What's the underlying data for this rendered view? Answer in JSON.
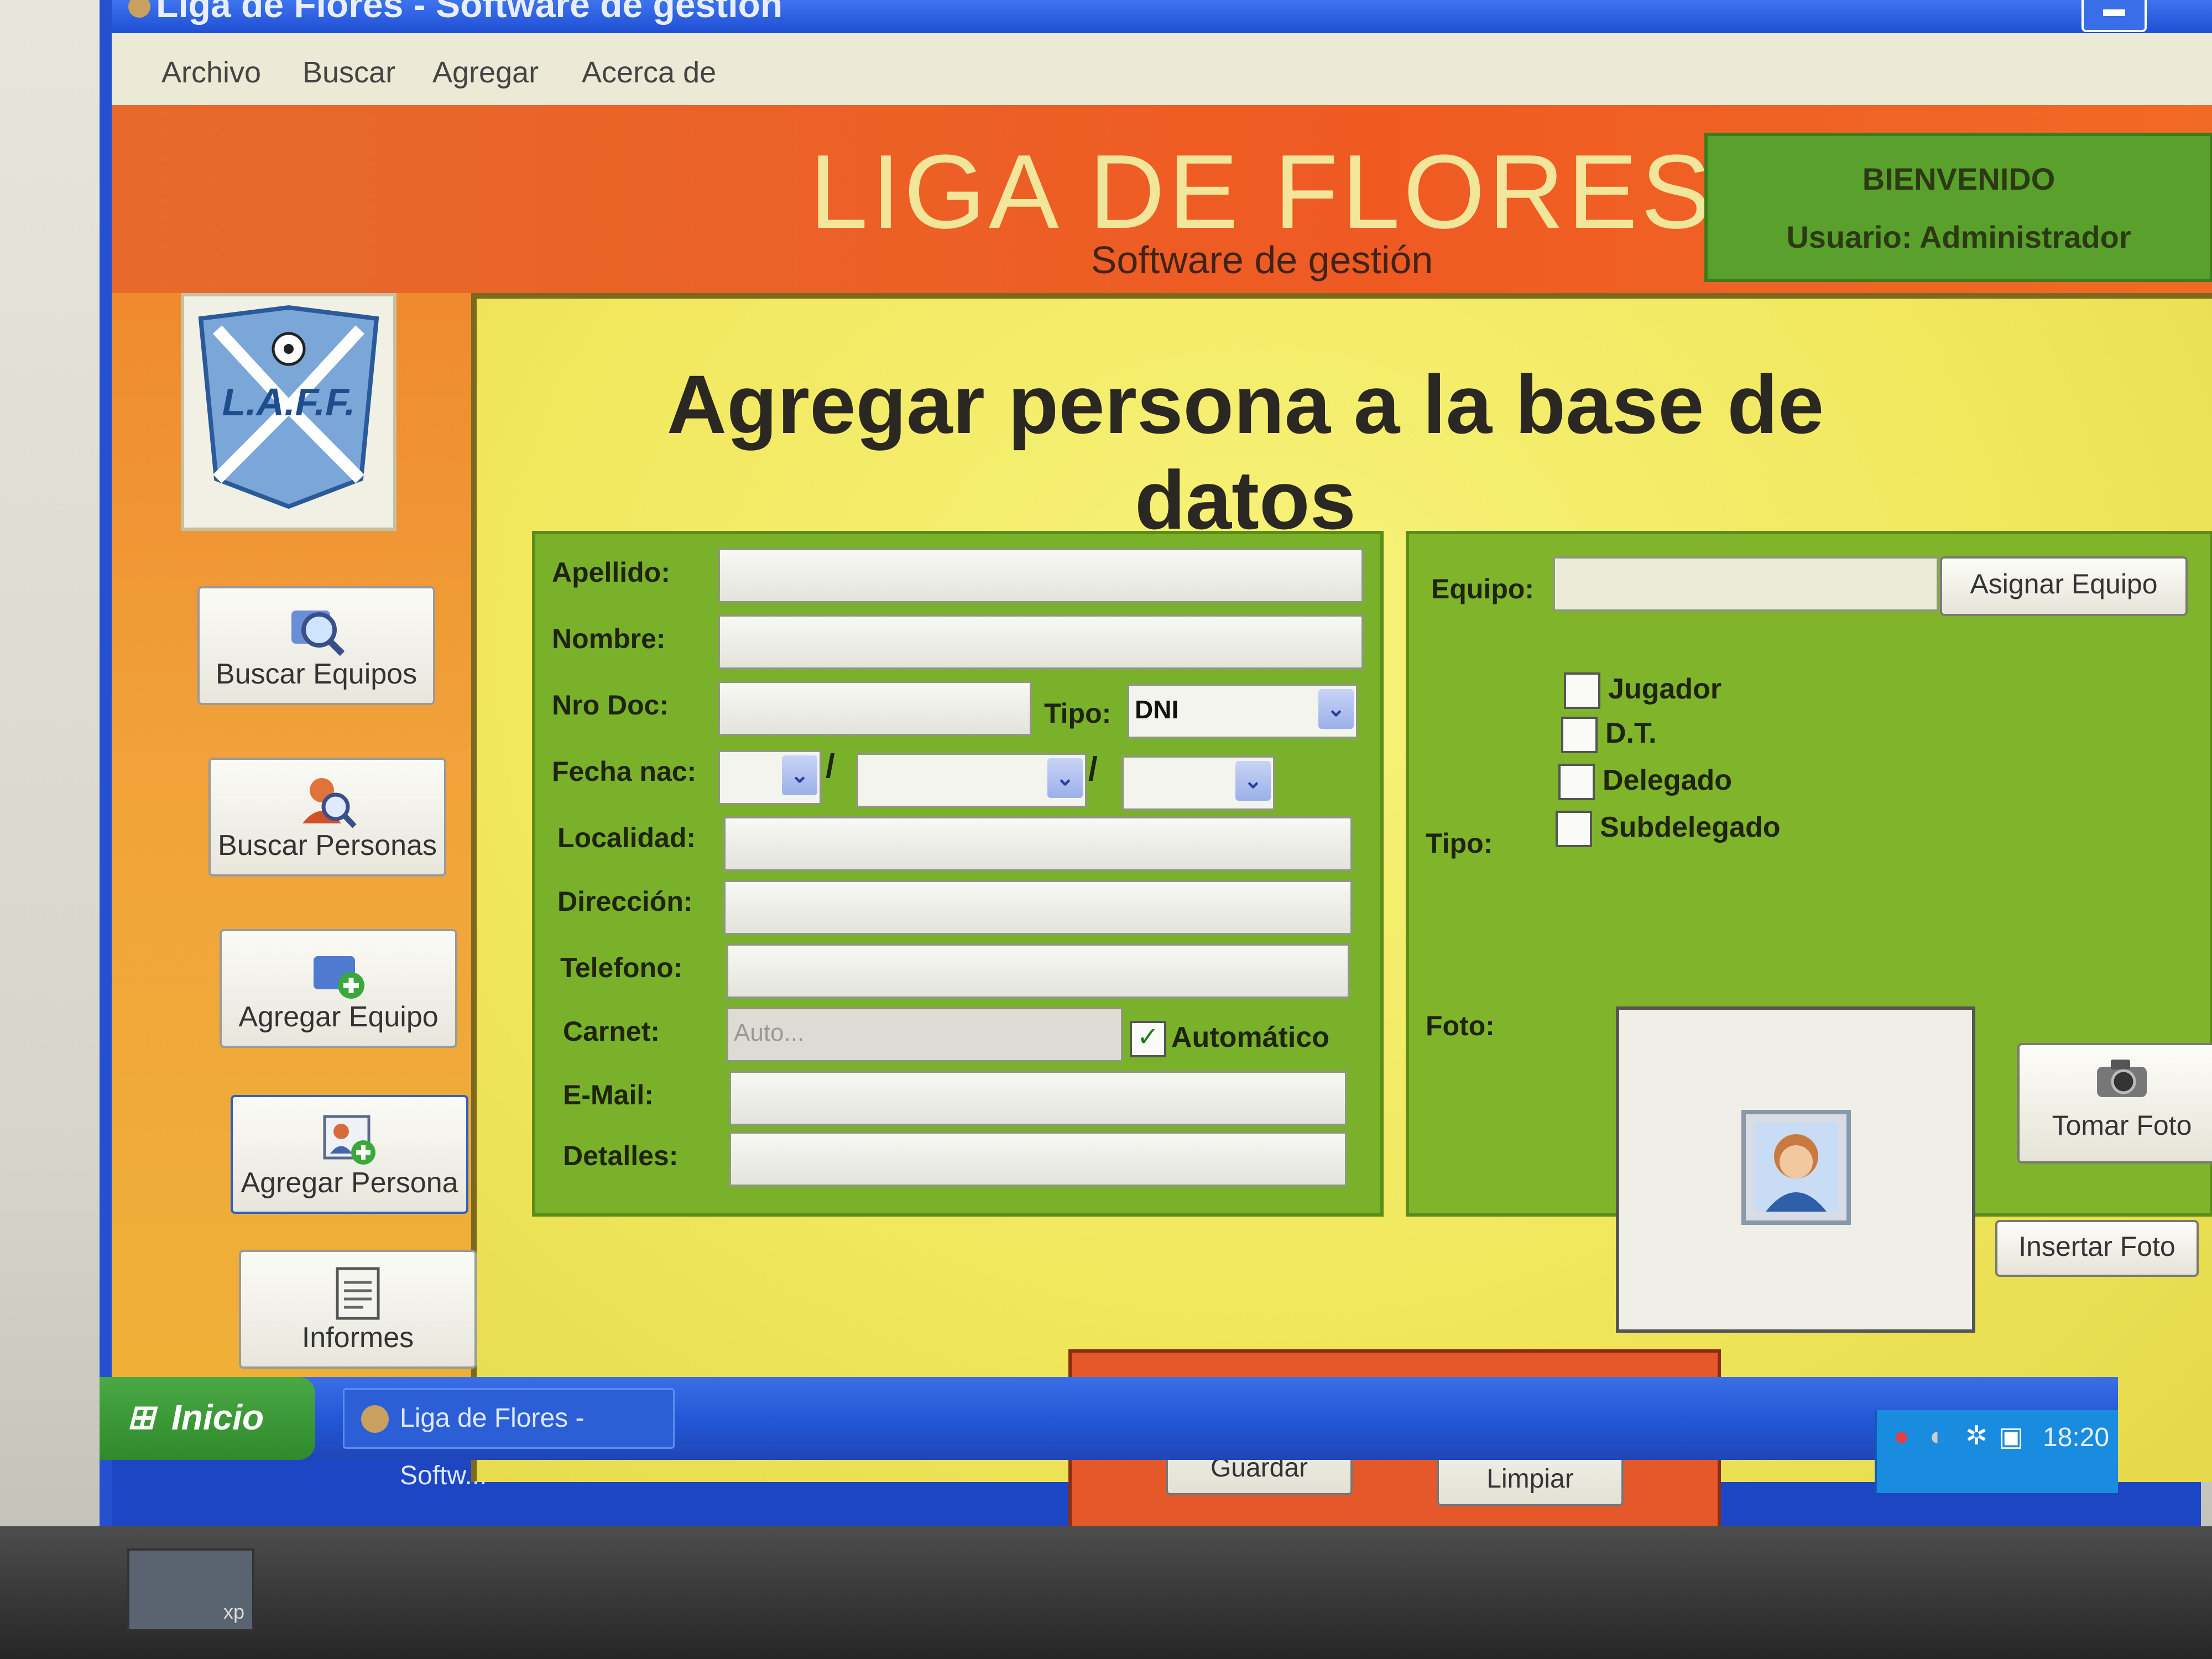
{
  "window": {
    "title": "Liga de Flores - Software de gestión"
  },
  "menu": [
    "Archivo",
    "Buscar",
    "Agregar",
    "Acerca de"
  ],
  "header": {
    "app_title": "LIGA DE FLORES",
    "app_subtitle": "Software de gestión",
    "welcome": "BIENVENIDO",
    "user": "Usuario: Administrador"
  },
  "sidebar": {
    "buttons": [
      {
        "label": "Buscar Equipos",
        "icon": "search-teams-icon"
      },
      {
        "label": "Buscar Personas",
        "icon": "search-person-icon"
      },
      {
        "label": "Agregar Equipo",
        "icon": "add-team-icon"
      },
      {
        "label": "Agregar Persona",
        "icon": "add-person-icon"
      },
      {
        "label": "Informes",
        "icon": "report-icon"
      }
    ]
  },
  "page_title": "Agregar persona a la base de datos",
  "form": {
    "apellido_label": "Apellido:",
    "nombre_label": "Nombre:",
    "nrodoc_label": "Nro Doc:",
    "tipo_label": "Tipo:",
    "tipo_value": "DNI",
    "fecha_label": "Fecha nac:",
    "date_sep": "/",
    "localidad_label": "Localidad:",
    "direccion_label": "Dirección:",
    "telefono_label": "Telefono:",
    "carnet_label": "Carnet:",
    "carnet_placeholder": "Auto...",
    "automatico_label": "Automático",
    "automatico_checked": true,
    "email_label": "E-Mail:",
    "detalles_label": "Detalles:"
  },
  "right": {
    "equipo_label": "Equipo:",
    "asignar_btn": "Asignar Equipo",
    "tipo_label": "Tipo:",
    "roles": [
      "Jugador",
      "D.T.",
      "Delegado",
      "Subdelegado"
    ],
    "foto_label": "Foto:",
    "tomar_btn": "Tomar Foto",
    "insertar_btn": "Insertar Foto"
  },
  "actions": {
    "guardar": "Guardar",
    "limpiar": "Limpiar"
  },
  "taskbar": {
    "start": "Inicio",
    "task": "Liga de Flores - Softw...",
    "clock": "18:20"
  },
  "bezel": {
    "xp_label": "xp"
  },
  "colors": {
    "header": "#ef5a23",
    "panel_green": "#7ab12a",
    "content_yellow": "#f1e85e",
    "welcome_green": "#5aa02c"
  }
}
